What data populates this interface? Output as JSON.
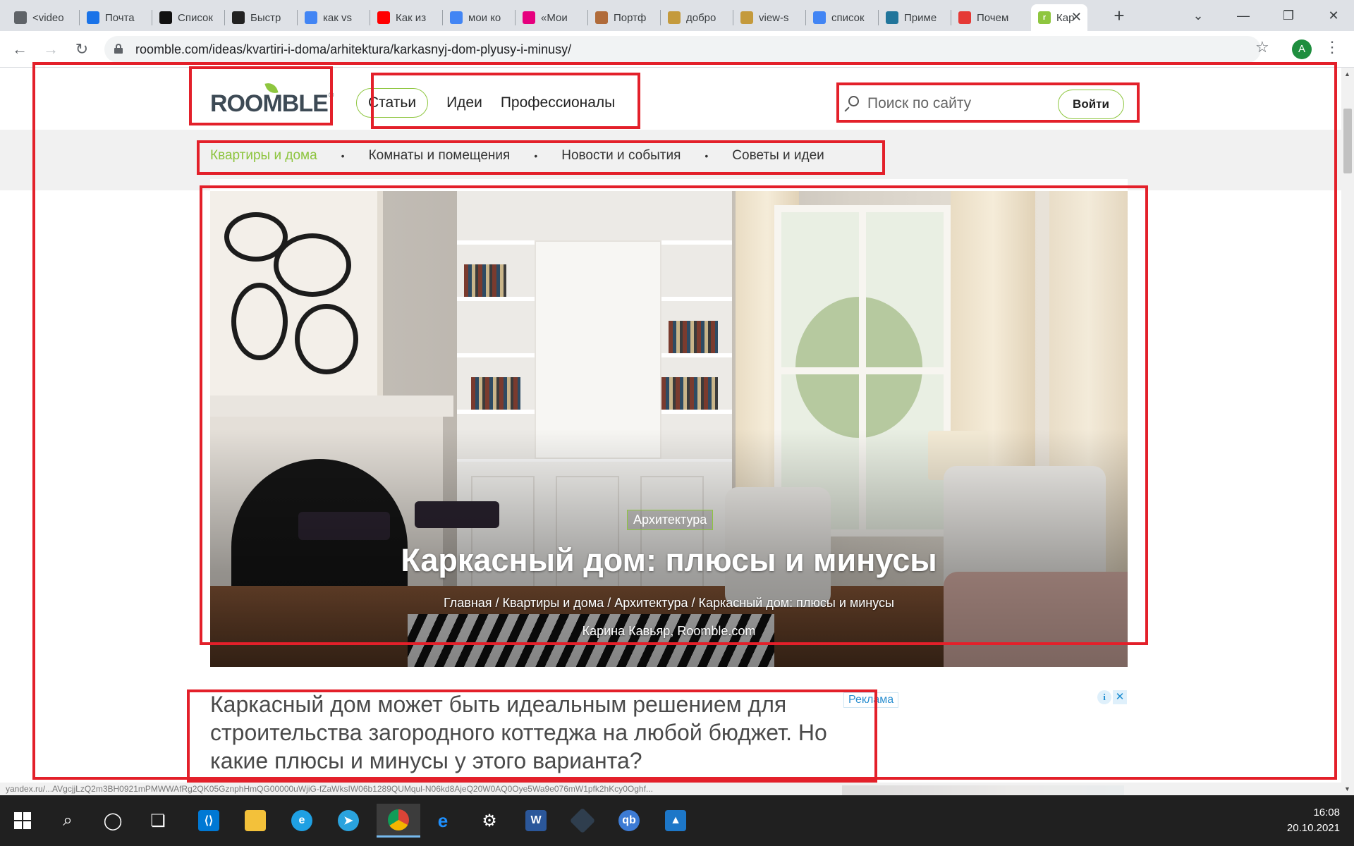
{
  "browser": {
    "tabs": [
      {
        "title": "<video",
        "icon": "chat-icon",
        "color": "#5f6368"
      },
      {
        "title": "Почта",
        "icon": "mail-icon",
        "color": "#1a73e8"
      },
      {
        "title": "Список",
        "icon": "tm-icon",
        "color": "#111111"
      },
      {
        "title": "Быстр",
        "icon": "chart-icon",
        "color": "#222222"
      },
      {
        "title": "как vs",
        "icon": "google-icon",
        "color": "#4285f4"
      },
      {
        "title": "Как из",
        "icon": "youtube-icon",
        "color": "#ff0000"
      },
      {
        "title": "мои ко",
        "icon": "google-icon",
        "color": "#4285f4"
      },
      {
        "title": "«Мои",
        "icon": "z-icon",
        "color": "#e6007e"
      },
      {
        "title": "Портф",
        "icon": "portrait-icon",
        "color": "#b06b3a"
      },
      {
        "title": "добро",
        "icon": "triangle-icon",
        "color": "#c49a3c"
      },
      {
        "title": "view-s",
        "icon": "triangle-icon",
        "color": "#c49a3c"
      },
      {
        "title": "список",
        "icon": "google-icon",
        "color": "#4285f4"
      },
      {
        "title": "Приме",
        "icon": "wordpress-icon",
        "color": "#21759b"
      },
      {
        "title": "Почем",
        "icon": "checker-icon",
        "color": "#e53935"
      }
    ],
    "active_tab": {
      "title": "Кар",
      "icon": "roomble-icon",
      "color": "#8ec63f"
    },
    "new_tab": "+",
    "url": "roomble.com/ideas/kvartiri-i-doma/arhitektura/karkasnyj-dom-plyusy-i-minusy/",
    "profile_letter": "A"
  },
  "site": {
    "logo_text": "ROOMBLE",
    "nav": [
      "Статьи",
      "Идеи",
      "Профессионалы"
    ],
    "search_placeholder": "Поиск по сайту",
    "login_label": "Войти",
    "subnav": [
      "Квартиры и дома",
      "Комнаты и помещения",
      "Новости и события",
      "Советы и идеи"
    ],
    "subnav_separator": "•",
    "accent_color": "#8ec63f"
  },
  "hero": {
    "category": "Архитектура",
    "title": "Каркасный дом: плюсы и минусы",
    "breadcrumbs": [
      "Главная",
      "Квартиры и дома",
      "Архитектура",
      "Каркасный дом: плюсы и минусы"
    ],
    "breadcrumb_separator": "/",
    "author": "Карина Кавьяр, Roomble.com"
  },
  "article": {
    "lead": "Каркасный дом может быть идеальным решением для строительства загородного коттеджа на любой бюджет. Но какие плюсы и минусы у этого варианта?"
  },
  "ad": {
    "label": "Реклама",
    "info": "i",
    "close": "✕"
  },
  "status_url": "yandex.ru/...AVgcjjLzQ2m3BH0921mPMWWAfRg2QK05GznphHmQG00000uWjiG-fZaWksIW06b1289QUMqul-N06kd8AjeQ20W0AQ0Oye5Wa9e076mW1pfk2hKcy0Oghf...",
  "taskbar": {
    "time": "16:08",
    "date": "20.10.2021"
  }
}
